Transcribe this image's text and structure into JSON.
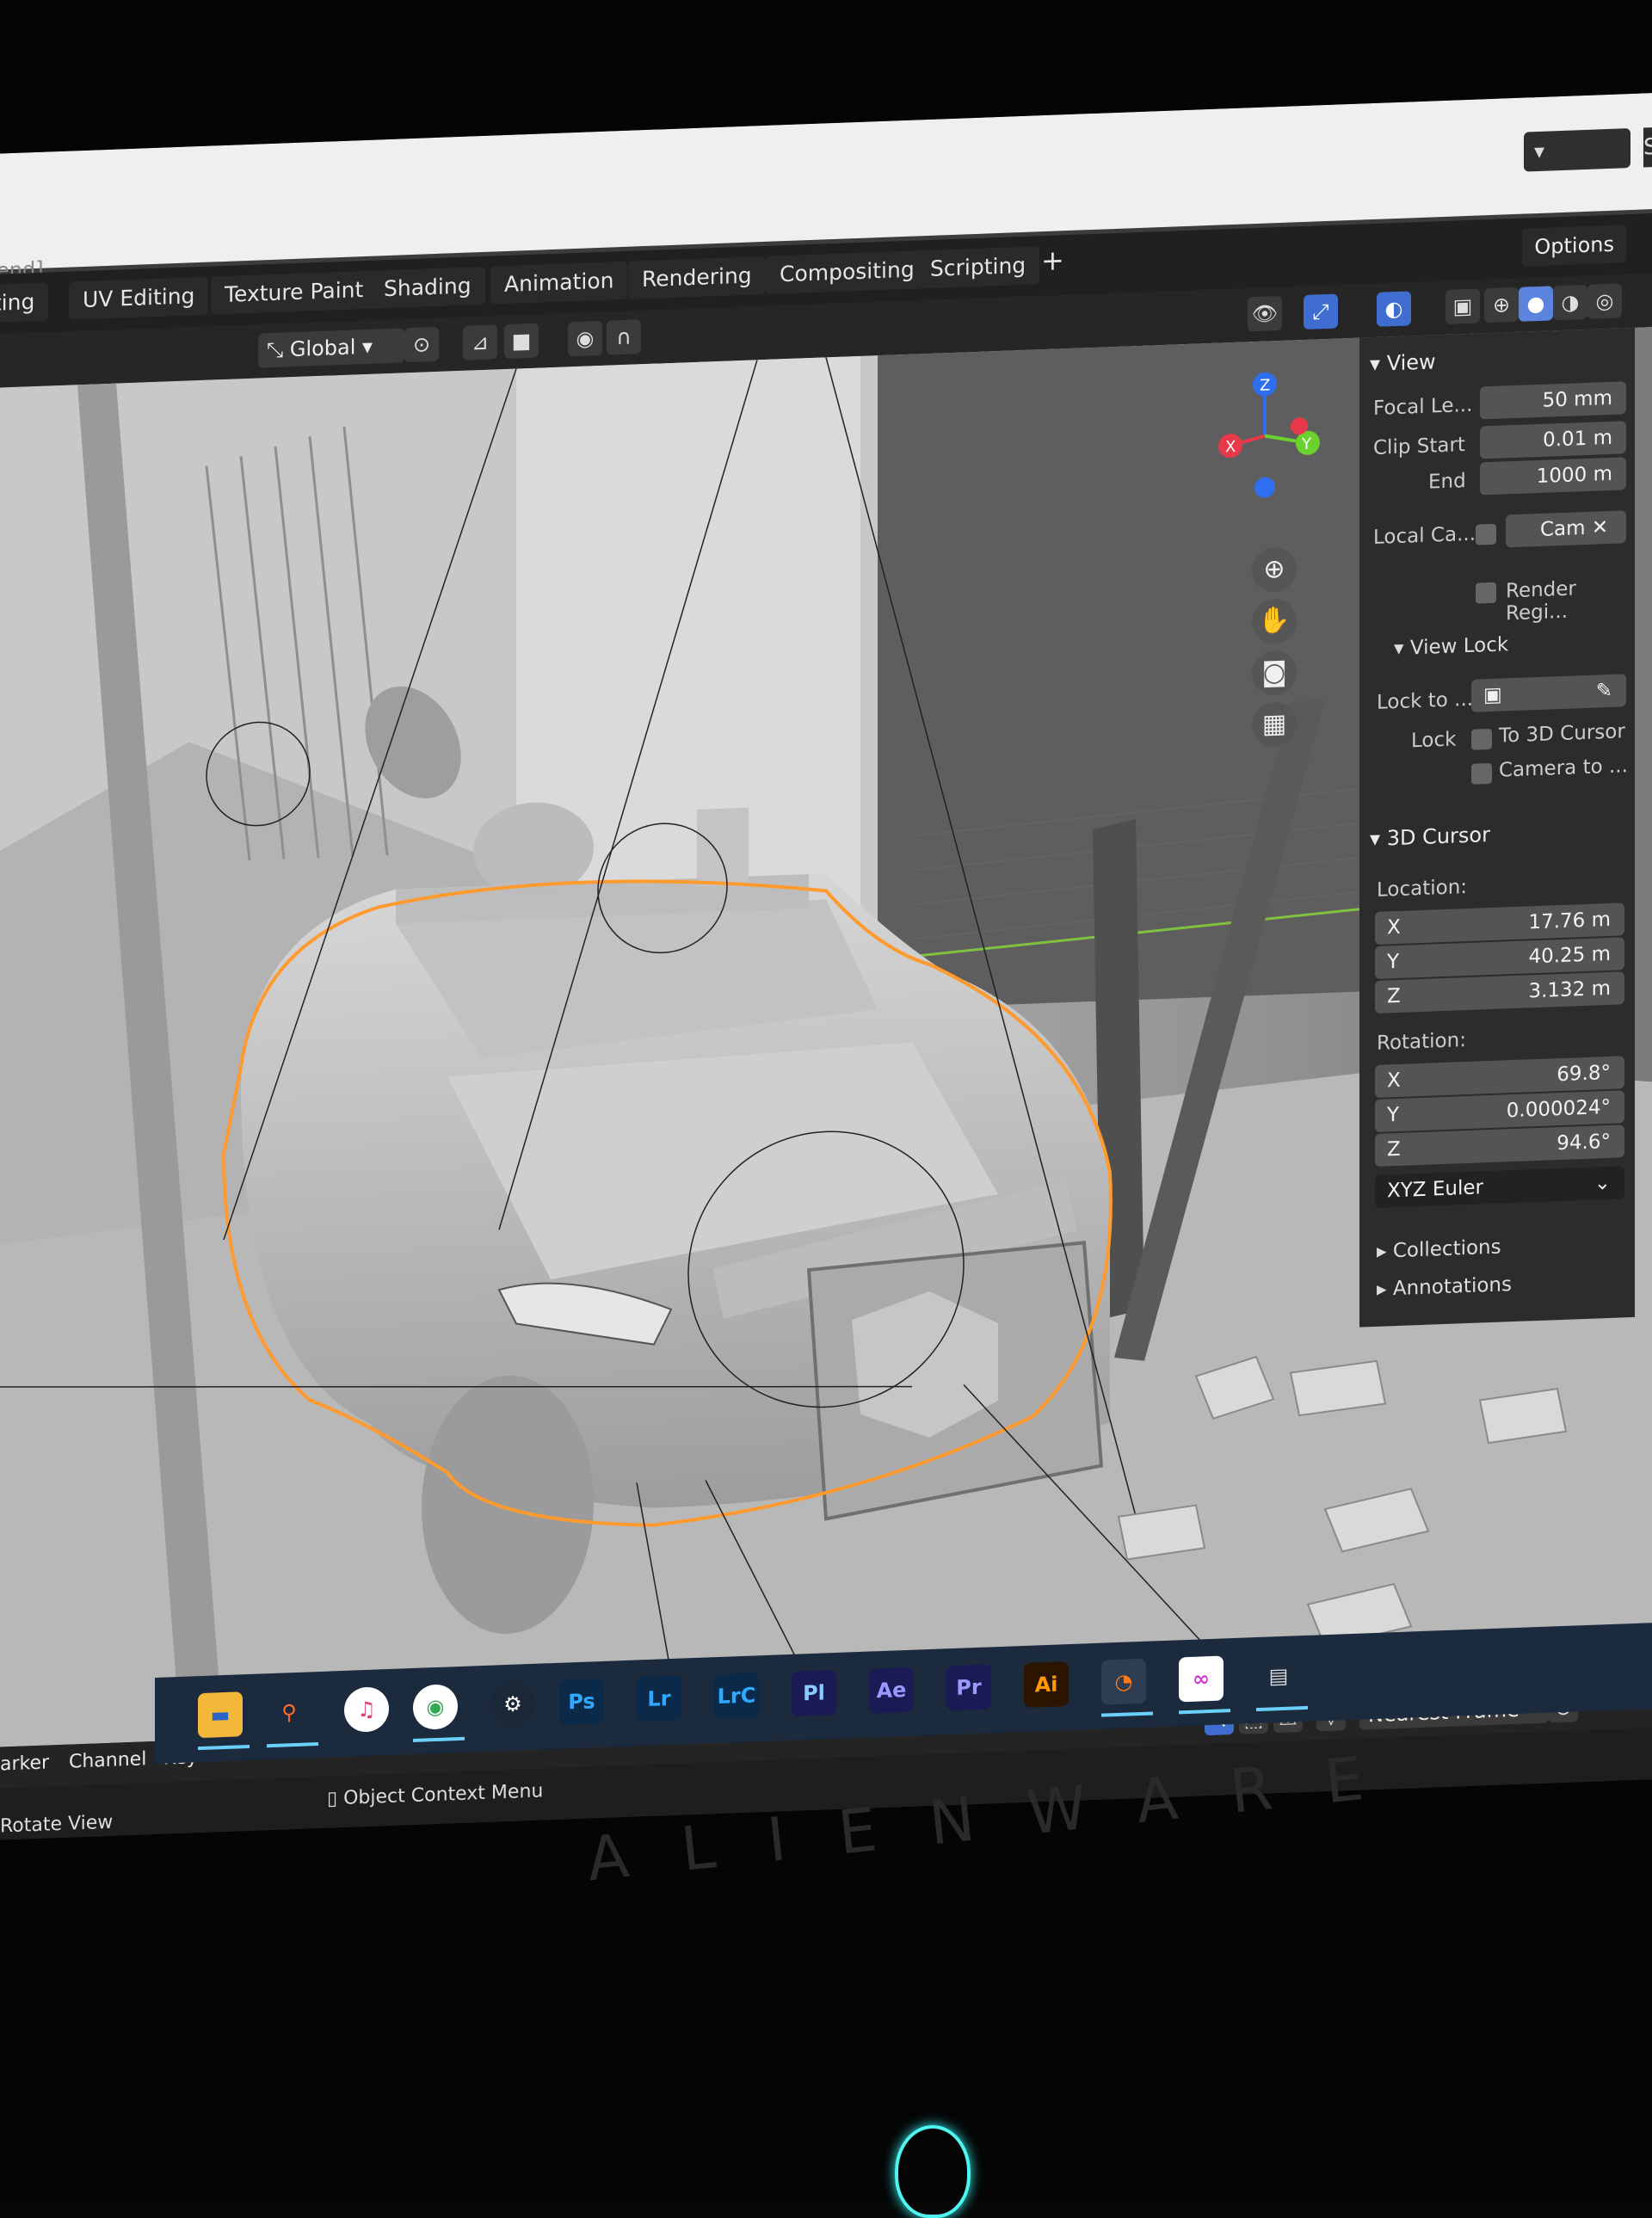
{
  "window": {
    "title_fragment": "end]",
    "scene_label": "Sc"
  },
  "workspace_tabs": [
    "pting",
    "UV Editing",
    "Texture Paint",
    "Shading",
    "Animation",
    "Rendering",
    "Compositing",
    "Scripting"
  ],
  "options_label": "Options",
  "header": {
    "transform_orientation": "Global"
  },
  "sidebar": {
    "view_panel": {
      "title": "View",
      "focal_length_label": "Focal Le...",
      "focal_length_value": "50 mm",
      "clip_start_label": "Clip Start",
      "clip_start_value": "0.01 m",
      "clip_end_label": "End",
      "clip_end_value": "1000 m",
      "local_camera_label": "Local Ca...",
      "local_camera_value": "Cam",
      "render_region_label": "Render Regi..."
    },
    "view_lock": {
      "title": "View Lock",
      "lock_to_label": "Lock to ...",
      "lock_label": "Lock",
      "to_3d_cursor_label": "To 3D Cursor",
      "camera_to_label": "Camera to ..."
    },
    "cursor_panel": {
      "title": "3D Cursor",
      "location_label": "Location:",
      "loc_x_label": "X",
      "loc_x": "17.76 m",
      "loc_y_label": "Y",
      "loc_y": "40.25 m",
      "loc_z_label": "Z",
      "loc_z": "3.132 m",
      "rotation_label": "Rotation:",
      "rot_x_label": "X",
      "rot_x": "69.8°",
      "rot_y_label": "Y",
      "rot_y": "0.000024°",
      "rot_z_label": "Z",
      "rot_z": "94.6°",
      "rotation_mode": "XYZ Euler"
    },
    "collections_label": "Collections",
    "annotations_label": "Annotations"
  },
  "gizmo": {
    "z": "Z",
    "x": "X",
    "y": "Y"
  },
  "timeline": {
    "marker_label": "arker",
    "channel_label": "Channel",
    "key_label": "Key",
    "snap_label": "Nearest Frame"
  },
  "status_bar": {
    "rotate_view": "Rotate View",
    "context_menu": "Object Context Menu"
  },
  "taskbar": {
    "apps": [
      "Ps",
      "Lr",
      "LrC",
      "Pl",
      "Ae",
      "Pr",
      "Ai"
    ]
  },
  "bezel": {
    "brand": "ALIENWARE"
  },
  "colors": {
    "selection_outline": "#ff9a2e",
    "blender_blue": "#3f6ed0",
    "axis_x": "#e8394a",
    "axis_y": "#6bd12f",
    "axis_z": "#2f6ef0"
  }
}
